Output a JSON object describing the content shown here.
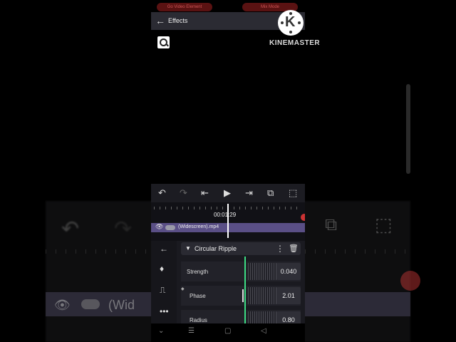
{
  "screen": {
    "top_bar": {
      "pill_left": "Go Video Element",
      "pill_right": "Mix Mode",
      "title": "Effects"
    },
    "toolbar": {
      "undo_icon": "undo-icon",
      "redo_icon": "redo-icon",
      "skip_start_icon": "skip-start-icon",
      "play_icon": "play-icon",
      "skip_end_icon": "skip-end-icon",
      "layers_icon": "layers-icon",
      "crop_icon": "crop-icon"
    },
    "timeline": {
      "timecode": "00:01:29",
      "clip_name": "(Widescreen).mp4"
    },
    "effect_panel": {
      "name": "Circular Ripple",
      "params": [
        {
          "label": "Strength",
          "value": "0.040"
        },
        {
          "label": "Phase",
          "value": "2.01"
        },
        {
          "label": "Radius",
          "value": "0.80"
        }
      ]
    },
    "background_ghost": {
      "clip_text": "(Wid"
    }
  },
  "watermark": {
    "letter": "K",
    "text": "KINEMASTER"
  },
  "colors": {
    "accent": "#3ddc84",
    "clip": "#5a4f86",
    "danger": "#c33333"
  }
}
